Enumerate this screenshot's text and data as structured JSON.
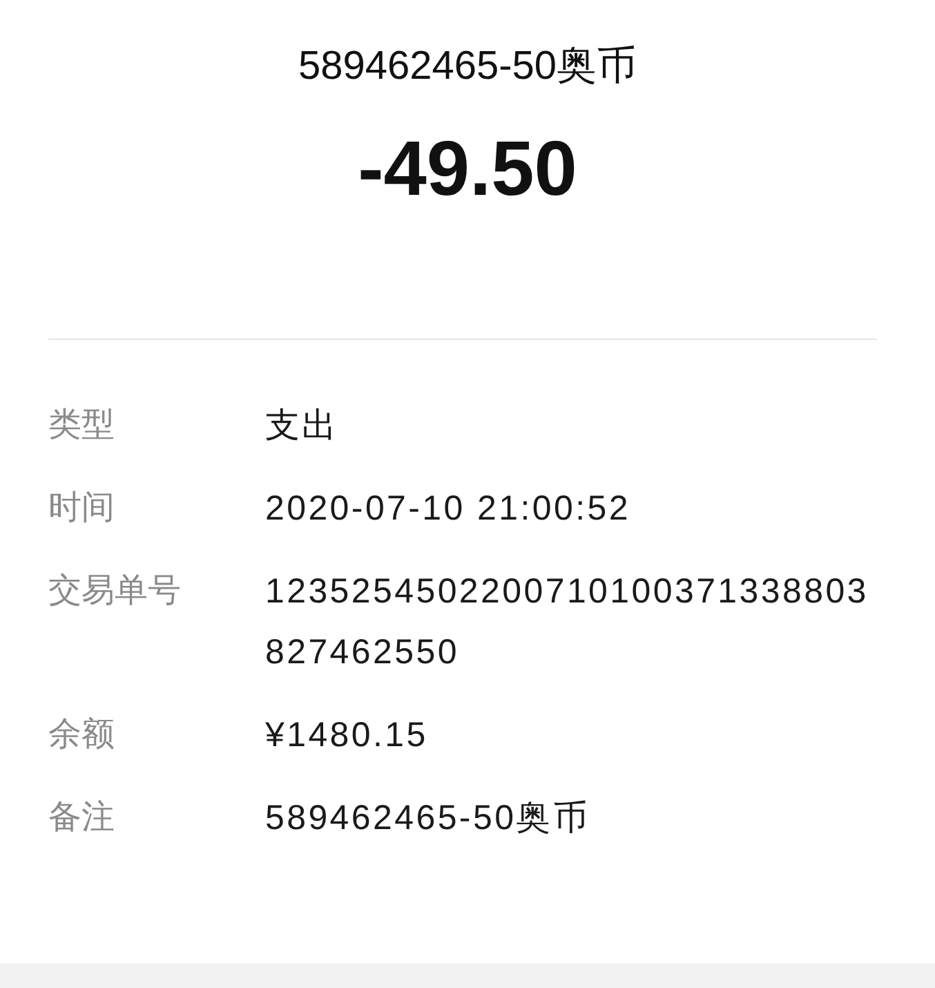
{
  "title": "589462465-50奥币",
  "amount": "-49.50",
  "details": [
    {
      "label": "类型",
      "value": "支出"
    },
    {
      "label": "时间",
      "value": "2020-07-10 21:00:52"
    },
    {
      "label": "交易单号",
      "value": "1235254502200710100371338803827462550"
    },
    {
      "label": "余额",
      "value": "¥1480.15"
    },
    {
      "label": "备注",
      "value": "589462465-50奥币"
    }
  ]
}
